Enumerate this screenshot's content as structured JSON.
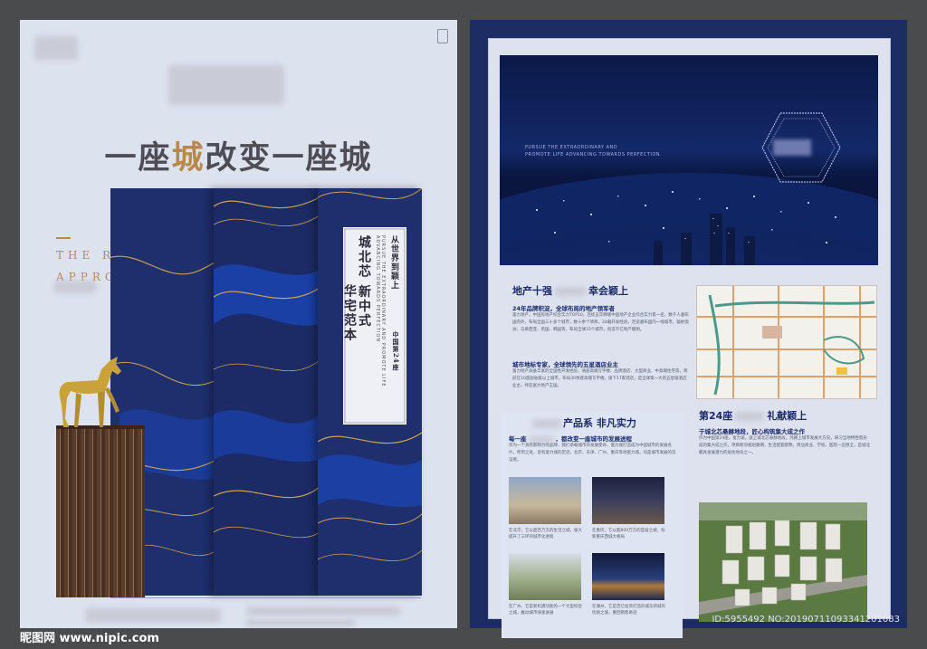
{
  "left_page": {
    "headline_part1": "一座",
    "headline_highlight": "城",
    "headline_part2": "改变一座城",
    "english_line1": "THE RICH",
    "english_line2": "APPROACH",
    "label_vertical_1": "从世界到颖上",
    "label_vertical_2": "中国第24座",
    "label_vertical_3": "城北芯 新中式",
    "label_vertical_4": "华宅范本",
    "label_english": "PURSUE THE EXTRAORDINARY AND PROMOTE LIFE ADVANCING TOWARDS PERFECTION"
  },
  "right_page": {
    "city_english": "PURSUE THE EXTRAORDINARY AND\nPROMOTE LIFE ADVANCING TOWARDS PERFECTION.",
    "section1_title_a": "地产十强",
    "section1_title_b": "幸会颖上",
    "section1_sub1": "24年品牌积淀，全球布局的地产领军者",
    "section1_body1": "富力地产，中国房地产综合实力TOP10，连续五年蝉联中国地产企业综合实力第一名，数千人遍布国内外，布局全国三十多个城市，数十余个项目，24载开发经验，足迹遍布国内一线城市，辐射澳洲、马来西亚、英国、韩国等，布局全球33个城市，创造千亿地产版图。",
    "section1_sub2": "城市地标专家，全球领先的五星酒店业主",
    "section1_body2": "富力地产具备丰富的全国性开发经验，涵盖高端写字楼、品牌酒店、大型商业、中高端住宅等，目前在10座副省级以上城市，布局30余座高端写字楼，旗下17家酒店，是全球第一大的五星级酒店业主，缔造富力地产王国。",
    "product_title_a": "产品系",
    "product_title_b": "非凡实力",
    "product_sub_a": "每一座",
    "product_sub_b": "，都改变一座城市的发展进程",
    "product_body": "作为一个具有影响力的品牌，我们承载城市的发展使命，富力城打造成为中国城市的发展名片，所到之处，皆有富力城的足迹，北京、天津、广州、重庆等地富力城，均是城市发展的见证者。",
    "captions": [
      "在北京，它以超百万方的生活之城，极大提升了三环的城市化进程",
      "在重庆，它以超800万方的宜居之城，标新重庆西城大格局",
      "在广州，它是新机遇功能的一个大型综合之城，推动城市快速发展",
      "在湖州，它是百亿投资打造的城东新城的优质之城，重回销售奇迹"
    ],
    "section3_title_a": "第24座",
    "section3_title_b": "礼献颖上",
    "section3_sub": "于城北芯悬赫地段，匠心构筑集大成之作",
    "section3_body": "作为中国第24座，富力城，就上城北芯悬赫地段，凭颖上城市发展大方向，研习当地特性而形成的集大成之作，项目毗邻规划路网，生活配套醇熟，周边商业、学校、医院一应俱全，是城北最具发展潜力的居住地块之一。",
    "watermark": "昵图网 www.nipic.com",
    "image_id": "ID:5955492 NO:20190711093341201083"
  }
}
